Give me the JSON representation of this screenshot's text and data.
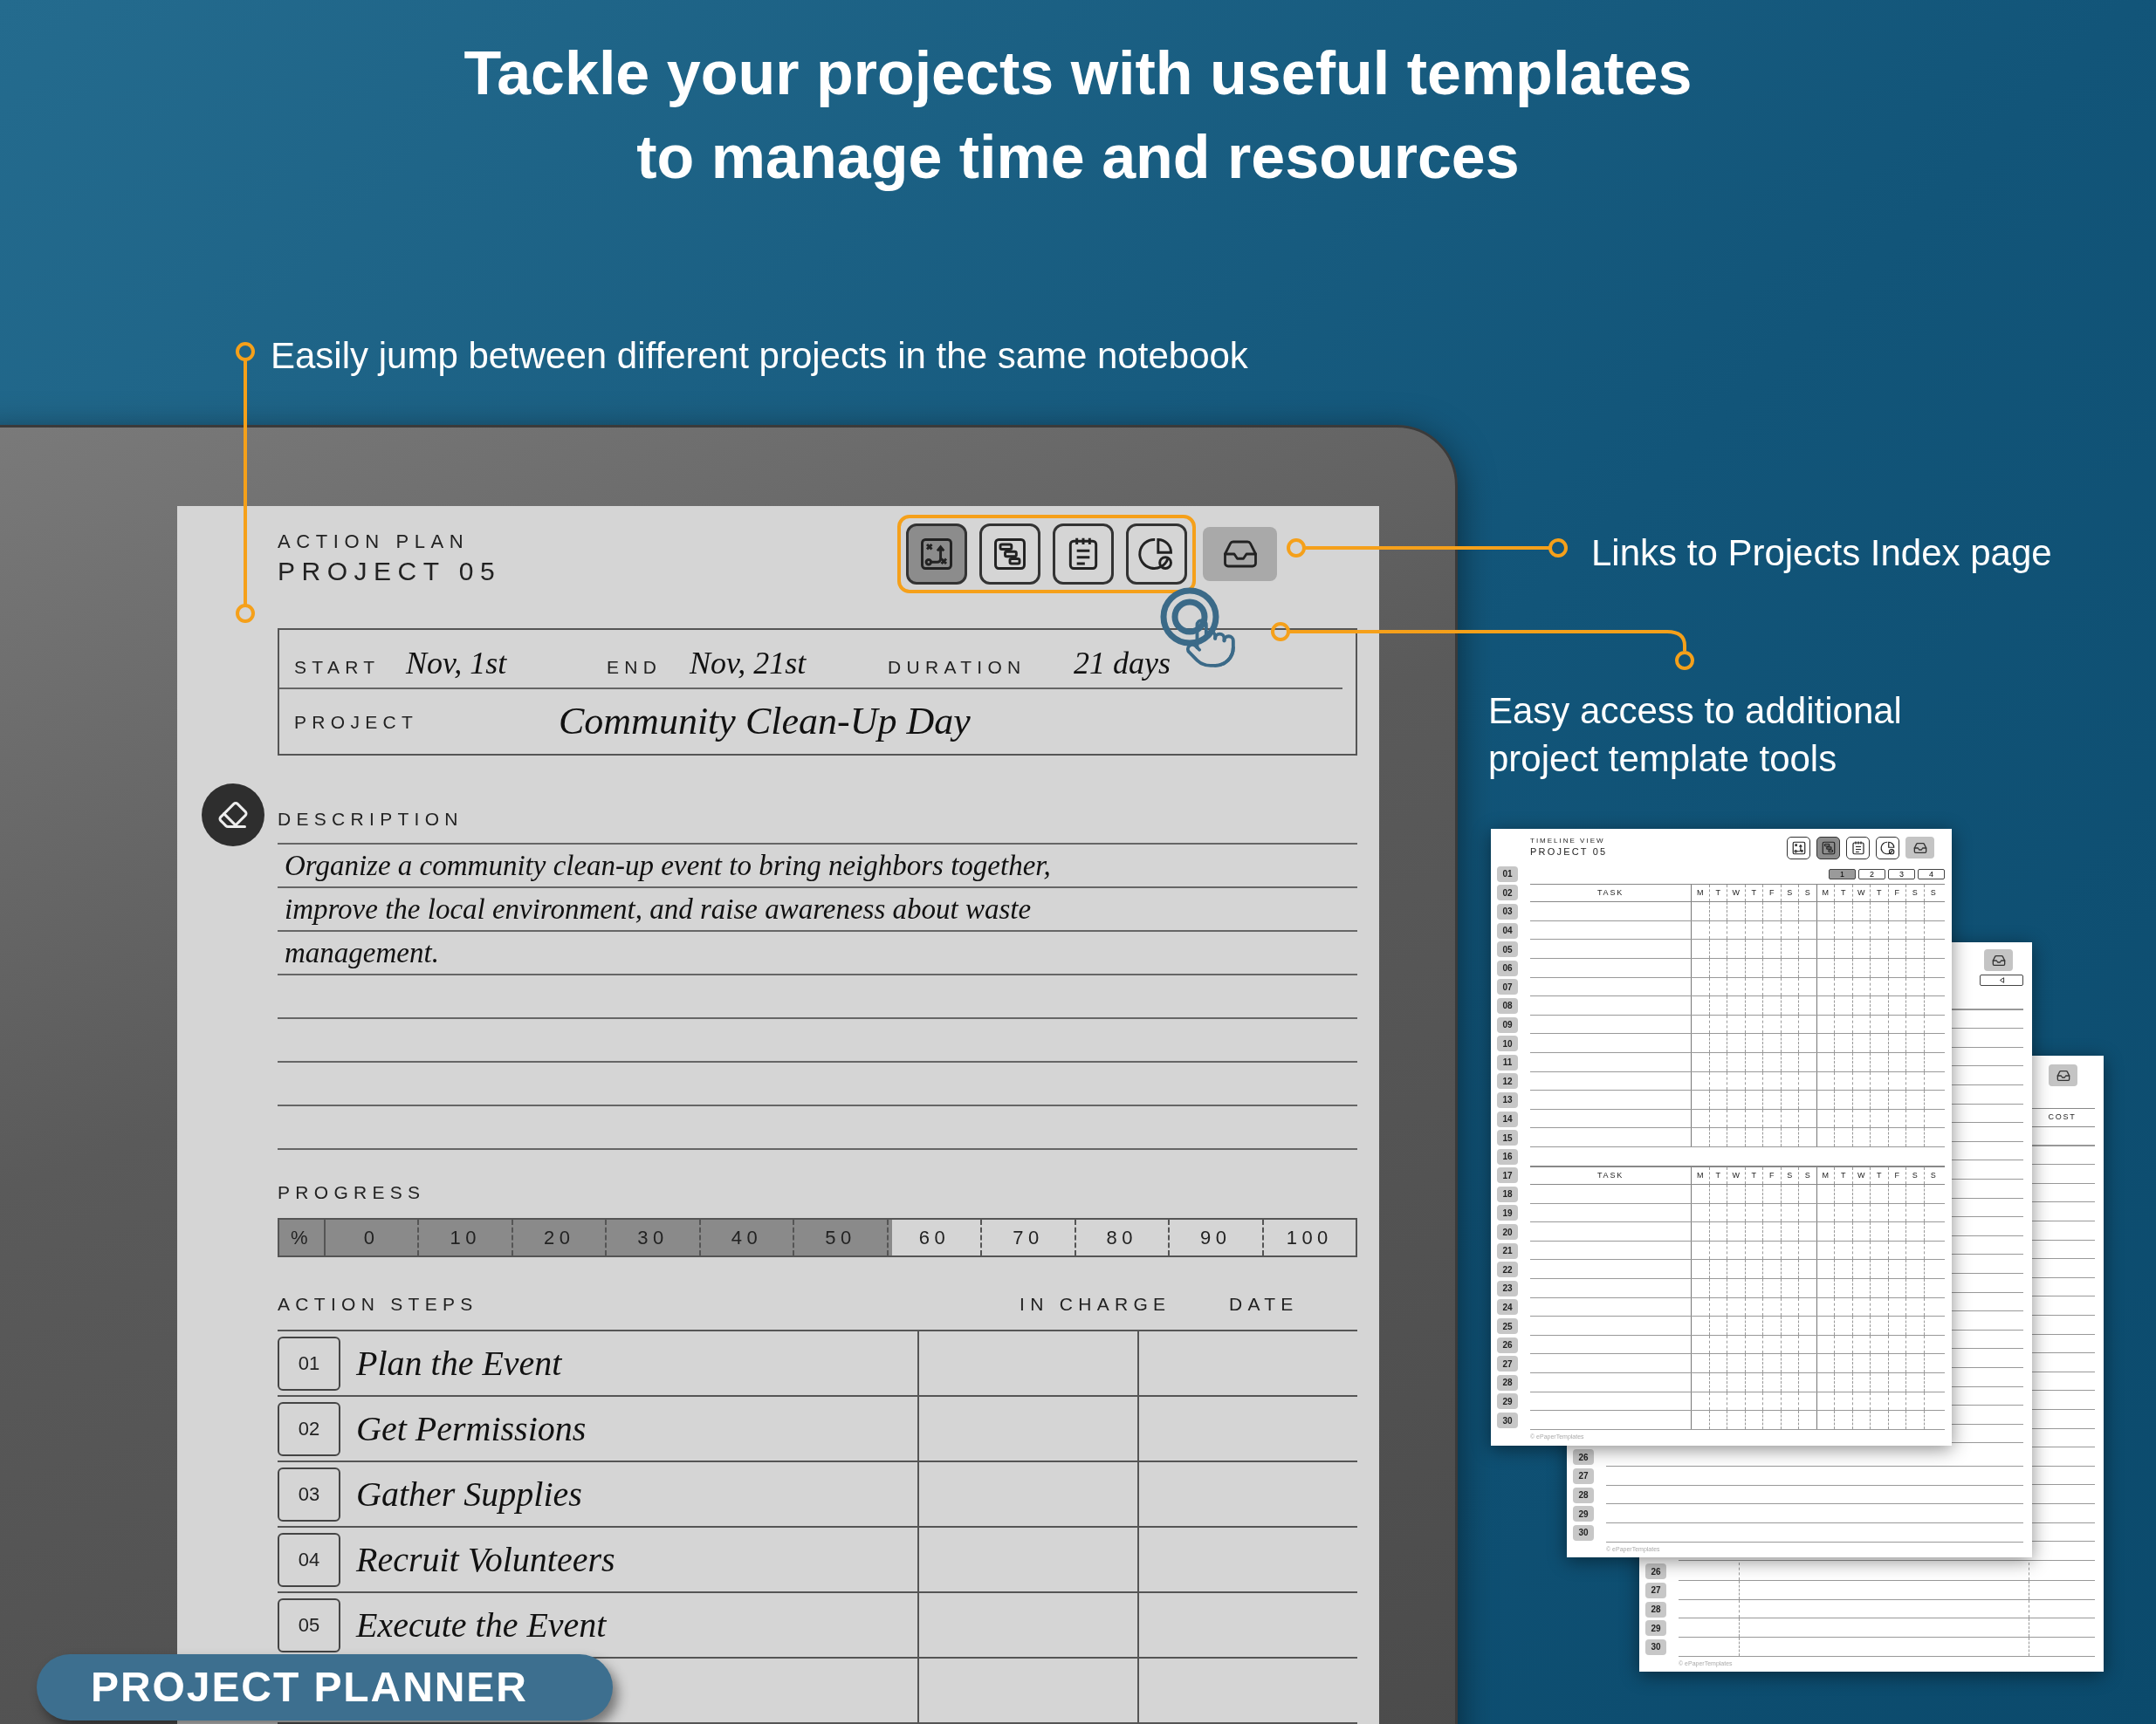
{
  "headline": [
    "Tackle your projects with useful templates",
    "to manage time and resources"
  ],
  "callout_jump": "Easily jump between different projects in the same notebook",
  "callout_index": "Links to Projects Index page",
  "callout_tools": [
    "Easy access to additional",
    "project template tools"
  ],
  "action_plan": {
    "title": "ACTION PLAN",
    "project": "PROJECT 05",
    "nav": [
      {
        "selected": true
      },
      {
        "selected": false
      },
      {
        "selected": false
      },
      {
        "selected": false
      }
    ],
    "fields": {
      "start_label": "START",
      "start": "Nov, 1st",
      "end_label": "END",
      "end": "Nov, 21st",
      "duration_label": "DURATION",
      "duration": "21 days",
      "project_label": "PROJECT",
      "project": "Community Clean-Up Day"
    },
    "description": {
      "label": "DESCRIPTION",
      "lines": [
        "Organize a community clean-up event to bring neighbors together,",
        "improve the local environment, and raise awareness about waste",
        "management."
      ]
    },
    "progress": {
      "label": "PROGRESS",
      "scale": [
        "%",
        "0",
        "10",
        "20",
        "30",
        "40",
        "50",
        "60",
        "70",
        "80",
        "90",
        "100"
      ],
      "level": 0.55
    },
    "action_steps": {
      "columns": [
        "ACTION STEPS",
        "IN CHARGE",
        "DATE"
      ],
      "rows": [
        {
          "number": "01",
          "task": "Plan the Event"
        },
        {
          "number": "02",
          "task": "Get Permissions"
        },
        {
          "number": "03",
          "task": "Gather Supplies"
        },
        {
          "number": "04",
          "task": "Recruit Volunteers"
        },
        {
          "number": "05",
          "task": "Execute the Event"
        },
        {}
      ]
    }
  },
  "badge": "PROJECT PLANNER",
  "timeline_page": {
    "title": "TIMELINE VIEW",
    "project": "PROJECT 05",
    "nav": [
      {
        "selected": false
      },
      {
        "selected": true
      },
      {
        "selected": false
      },
      {
        "selected": false
      }
    ],
    "page_tabs": [
      {
        "label": "1",
        "selected": true
      },
      {
        "label": "2",
        "selected": false
      },
      {
        "label": "3",
        "selected": false
      },
      {
        "label": "4",
        "selected": false
      }
    ],
    "row_numbers": [
      "01",
      "02",
      "03",
      "04",
      "05",
      "06",
      "07",
      "08",
      "09",
      "10",
      "11",
      "12",
      "13",
      "14",
      "15",
      "16",
      "17",
      "18",
      "19",
      "20",
      "21",
      "22",
      "23",
      "24",
      "25",
      "26",
      "27",
      "28",
      "29",
      "30"
    ],
    "tables": [
      {
        "task_header": "TASK",
        "days": [
          "M",
          "T",
          "W",
          "T",
          "F",
          "S",
          "S",
          "M",
          "T",
          "W",
          "T",
          "F",
          "S",
          "S"
        ]
      },
      {
        "task_header": "TASK",
        "days": [
          "M",
          "T",
          "W",
          "T",
          "F",
          "S",
          "S",
          "M",
          "T",
          "W",
          "T",
          "F",
          "S",
          "S"
        ]
      }
    ],
    "footer": "© ePaperTemplates"
  },
  "second_page": {
    "row_numbers": [
      "26",
      "27",
      "28",
      "29",
      "30"
    ],
    "footer": "© ePaperTemplates"
  },
  "cost_page": {
    "column": "COST",
    "row_numbers": [
      "26",
      "27",
      "28",
      "29",
      "30"
    ],
    "footer": "© ePaperTemplates"
  }
}
